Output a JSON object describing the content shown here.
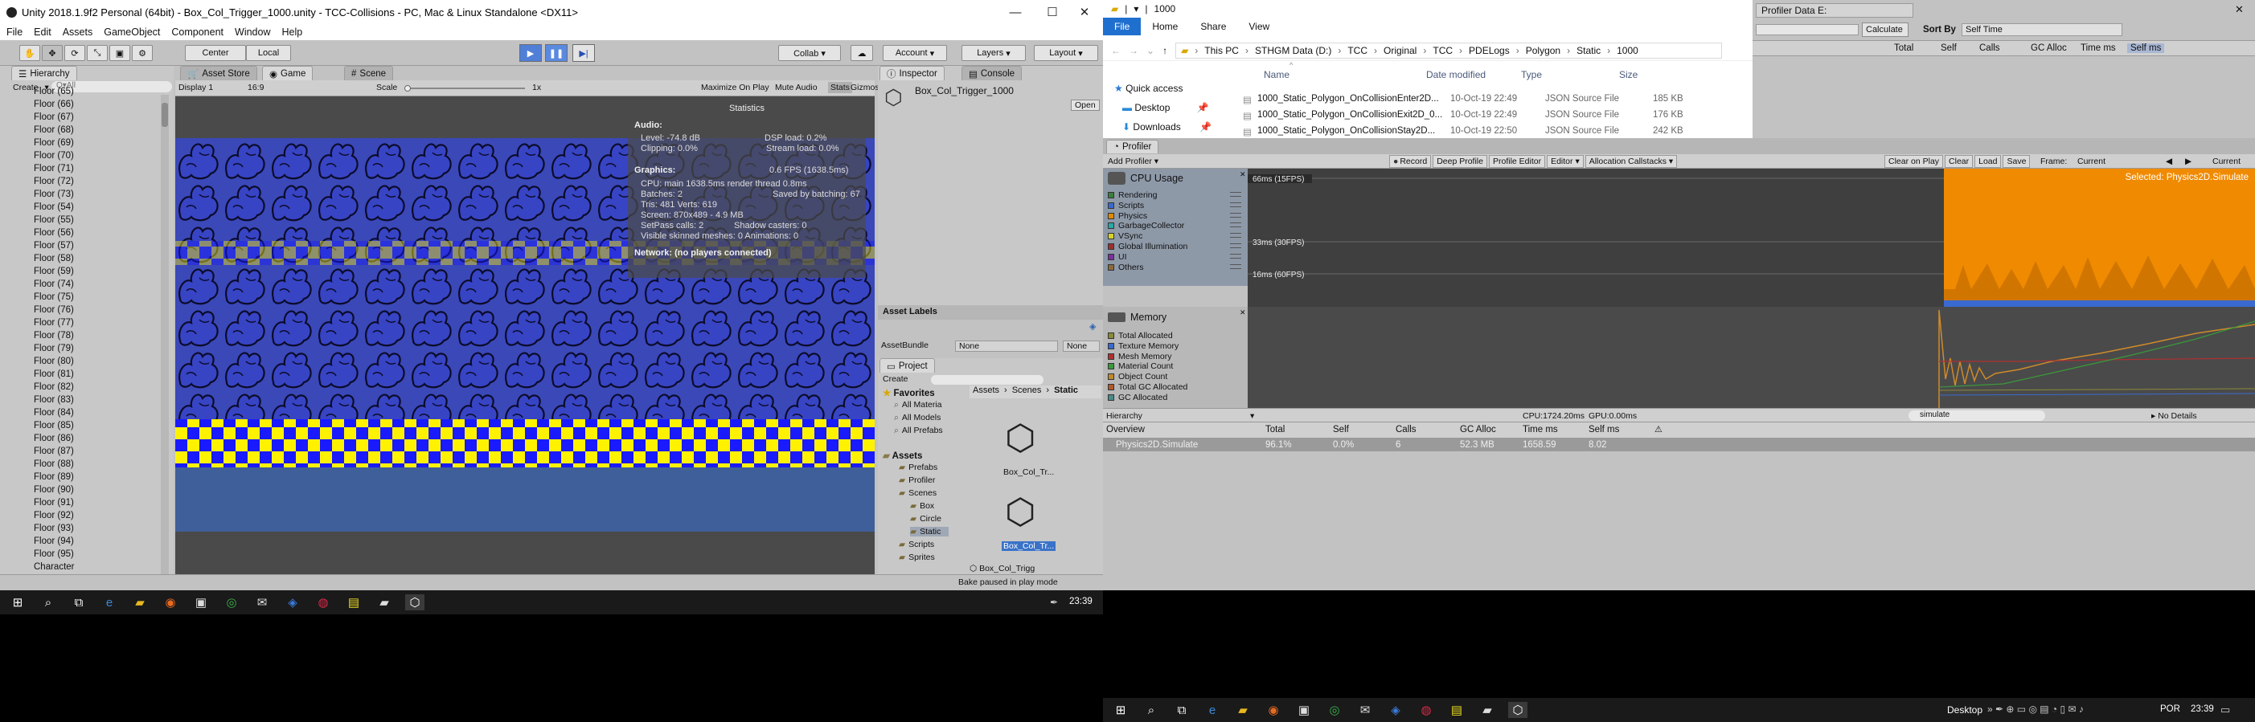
{
  "unity": {
    "title": "Unity 2018.1.9f2 Personal (64bit) - Box_Col_Trigger_1000.unity - TCC-Collisions - PC, Mac & Linux Standalone <DX11>",
    "menu": [
      "File",
      "Edit",
      "Assets",
      "GameObject",
      "Component",
      "Window",
      "Help"
    ],
    "toolbar": {
      "center": "Center",
      "local": "Local",
      "collab": "Collab ▾",
      "account": "Account",
      "layers": "Layers",
      "layout": "Layout"
    },
    "hierarchy": {
      "tab": "Hierarchy",
      "create": "Create",
      "search_placeholder": "Q▾All",
      "items": [
        "Floor (65)",
        "Floor (66)",
        "Floor (67)",
        "Floor (68)",
        "Floor (69)",
        "Floor (70)",
        "Floor (71)",
        "Floor (72)",
        "Floor (73)",
        "Floor (54)",
        "Floor (55)",
        "Floor (56)",
        "Floor (57)",
        "Floor (58)",
        "Floor (59)",
        "Floor (74)",
        "Floor (75)",
        "Floor (76)",
        "Floor (77)",
        "Floor (78)",
        "Floor (79)",
        "Floor (80)",
        "Floor (81)",
        "Floor (82)",
        "Floor (83)",
        "Floor (84)",
        "Floor (85)",
        "Floor (86)",
        "Floor (87)",
        "Floor (88)",
        "Floor (89)",
        "Floor (90)",
        "Floor (91)",
        "Floor (92)",
        "Floor (93)",
        "Floor (94)",
        "Floor (95)",
        "Character"
      ]
    },
    "game": {
      "tab_asset_store": "Asset Store",
      "tab_game": "Game",
      "tab_scene": "Scene",
      "display": "Display 1",
      "aspect": "16:9",
      "scale_label": "Scale",
      "scale_value": "1x",
      "maximize": "Maximize On Play",
      "mute": "Mute Audio",
      "stats": "Stats",
      "gizmos": "Gizmos"
    },
    "statistics": {
      "title": "Statistics",
      "audio_h": "Audio:",
      "level": "Level: -74.8 dB",
      "dsp": "DSP load: 0.2%",
      "clipping": "Clipping: 0.0%",
      "stream": "Stream load: 0.0%",
      "graphics_h": "Graphics:",
      "fps": "0.6 FPS (1638.5ms)",
      "cpu": "CPU: main 1638.5ms  render thread 0.8ms",
      "batches": "Batches: 2",
      "saved": "Saved by batching: 67",
      "tris": "Tris: 481  Verts: 619",
      "screen": "Screen: 870x489 - 4.9 MB",
      "setpass": "SetPass calls: 2",
      "shadow": "Shadow casters: 0",
      "skinned": "Visible skinned meshes: 0  Animations: 0",
      "network": "Network: (no players connected)"
    },
    "inspector": {
      "tab": "Inspector",
      "tab_console": "Console",
      "object_name": "Box_Col_Trigger_1000",
      "open": "Open",
      "asset_labels": "Asset Labels",
      "asset_bundle": "AssetBundle",
      "bundle_value": "None",
      "bundle_variant": "None"
    },
    "project": {
      "tab": "Project",
      "create": "Create",
      "favorites": "Favorites",
      "fav_items": [
        "All Materia",
        "All Models",
        "All Prefabs"
      ],
      "assets": "Assets",
      "asset_tree": [
        "Prefabs",
        "Profiler",
        "Scenes",
        "Box",
        "Circle",
        "Static",
        "Scripts",
        "Sprites"
      ],
      "breadcrumb": [
        "Assets",
        "Scenes",
        "Static"
      ],
      "files": [
        "Box_Col_Tr...",
        "Box_Col_Tr..."
      ],
      "footer_file": "Box_Col_Trigg",
      "status": "Bake paused in play mode"
    }
  },
  "explorer": {
    "title": "1000",
    "ribbon": [
      "File",
      "Home",
      "Share",
      "View"
    ],
    "path": [
      "This PC",
      "STHGM Data (D:)",
      "TCC",
      "Original",
      "TCC",
      "PDELogs",
      "Polygon",
      "Static",
      "1000"
    ],
    "nav": [
      "Quick access",
      "Desktop",
      "Downloads"
    ],
    "columns": [
      "Name",
      "Date modified",
      "Type",
      "Size"
    ],
    "files": [
      {
        "name": "1000_Static_Polygon_OnCollisionEnter2D...",
        "date": "10-Oct-19 22:49",
        "type": "JSON Source File",
        "size": "185 KB"
      },
      {
        "name": "1000_Static_Polygon_OnCollisionExit2D_0...",
        "date": "10-Oct-19 22:49",
        "type": "JSON Source File",
        "size": "176 KB"
      },
      {
        "name": "1000_Static_Polygon_OnCollisionStay2D...",
        "date": "10-Oct-19 22:50",
        "type": "JSON Source File",
        "size": "242 KB"
      }
    ]
  },
  "profiler_data": {
    "title": "Profiler Data E:",
    "calculate": "Calculate",
    "sort_by": "Sort By",
    "sort_value": "Self Time",
    "columns": [
      "Total",
      "Self",
      "Calls",
      "GC Alloc",
      "Time ms",
      "Self ms"
    ]
  },
  "profiler": {
    "tab": "Profiler",
    "add_profiler": "Add Profiler",
    "toolbar": [
      "Record",
      "Deep Profile",
      "Profile Editor",
      "Editor ▾",
      "Allocation Callstacks ▾"
    ],
    "right_toolbar": [
      "Clear on Play",
      "Clear",
      "Load",
      "Save"
    ],
    "frame_label": "Frame:",
    "frame_value": "Current",
    "current": "Current",
    "cpu_title": "CPU Usage",
    "cpu_legend": [
      {
        "name": "Rendering",
        "color": "#3b7f3b"
      },
      {
        "name": "Scripts",
        "color": "#3a6ad0"
      },
      {
        "name": "Physics",
        "color": "#e08a00"
      },
      {
        "name": "GarbageCollector",
        "color": "#2aa8a8"
      },
      {
        "name": "VSync",
        "color": "#d4d22a"
      },
      {
        "name": "Global Illumination",
        "color": "#9b2f2f"
      },
      {
        "name": "UI",
        "color": "#7a2fa0"
      },
      {
        "name": "Others",
        "color": "#8a6a3a"
      }
    ],
    "cpu_gridlines": [
      "66ms (15FPS)",
      "33ms (30FPS)",
      "16ms (60FPS)"
    ],
    "selected": "Selected: Physics2D.Simulate",
    "memory_title": "Memory",
    "memory_legend": [
      {
        "name": "Total Allocated",
        "color": "#8a8a3a"
      },
      {
        "name": "Texture Memory",
        "color": "#3a6ad0"
      },
      {
        "name": "Mesh Memory",
        "color": "#b03030"
      },
      {
        "name": "Material Count",
        "color": "#3a9a3a"
      },
      {
        "name": "Object Count",
        "color": "#c08a2a"
      },
      {
        "name": "Total GC Allocated",
        "color": "#b05a2a"
      },
      {
        "name": "GC Allocated",
        "color": "#4a8a8a"
      }
    ],
    "hierarchy_dropdown": "Hierarchy",
    "cpu_time": "CPU:1724.20ms",
    "gpu_time": "GPU:0.00ms",
    "search_value": "simulate",
    "details": "No Details",
    "table_columns": [
      "Overview",
      "Total",
      "Self",
      "Calls",
      "GC Alloc",
      "Time ms",
      "Self ms"
    ],
    "row": {
      "name": "Physics2D.Simulate",
      "total": "96.1%",
      "self": "0.0%",
      "calls": "6",
      "gc": "52.3 MB",
      "time": "1658.59",
      "self_ms": "8.02"
    }
  },
  "taskbar_left": {
    "time": "23:39"
  },
  "taskbar_right": {
    "desktop": "Desktop",
    "lang": "POR",
    "time": "23:39"
  }
}
